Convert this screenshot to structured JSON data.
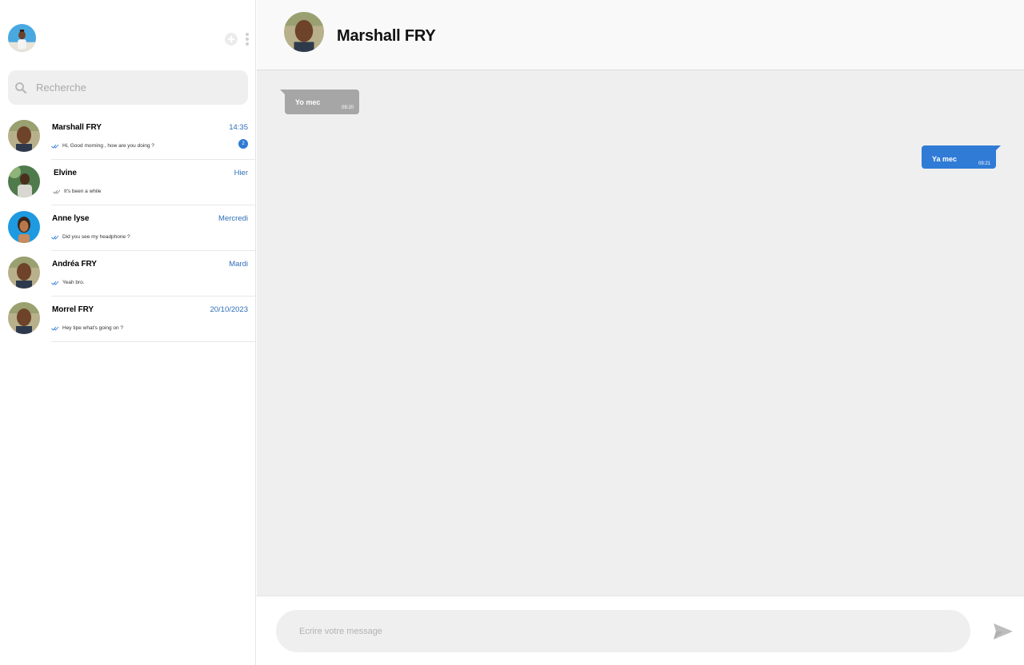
{
  "sidebar": {
    "search_placeholder": "Recherche",
    "conversations": [
      {
        "name": "Marshall FRY",
        "time": "14:35",
        "preview": "Hi, Good morning , how are you doing ?",
        "unread": "2"
      },
      {
        "name": "Elvine",
        "time": "Hier",
        "preview": "It's been a while"
      },
      {
        "name": "Anne lyse",
        "time": "Mercredi",
        "preview": "Did you see my headphone ?"
      },
      {
        "name": "Andréa FRY",
        "time": "Mardi",
        "preview": "Yeah bro."
      },
      {
        "name": "Morrel FRY",
        "time": "20/10/2023",
        "preview": "Hey tipe what's going on ?"
      }
    ]
  },
  "chat": {
    "title": "Marshall FRY",
    "messages": [
      {
        "direction": "incoming",
        "text": "Yo mec",
        "time": "09:20"
      },
      {
        "direction": "outgoing",
        "text": "Ya mec",
        "time": "09:21"
      }
    ],
    "composer_placeholder": "Ecrire votre message"
  },
  "colors": {
    "accent": "#2f7bd6",
    "incoming_bubble": "#a6a6a6",
    "chat_background": "#efefef",
    "time_text": "#2f6fb8"
  },
  "icons": [
    "new-chat-plus-icon",
    "kebab-menu-icon",
    "search-icon",
    "double-check-icon",
    "send-icon"
  ]
}
